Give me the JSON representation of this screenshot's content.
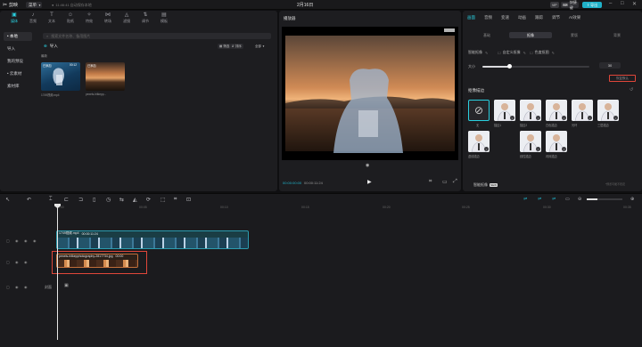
{
  "app": {
    "logo": "剪映",
    "menu_label": "菜单",
    "autosave": "11:46:41 自动保存本地",
    "doc_title": "2月16日",
    "vip_label": "VIP",
    "shortcut_label": "快捷键",
    "export_label": "导出"
  },
  "toolbar_tabs": [
    {
      "label": "媒体",
      "icon": "media-icon"
    },
    {
      "label": "音频",
      "icon": "audio-icon"
    },
    {
      "label": "文本",
      "icon": "text-icon"
    },
    {
      "label": "贴纸",
      "icon": "sticker-icon"
    },
    {
      "label": "特效",
      "icon": "effect-icon"
    },
    {
      "label": "转场",
      "icon": "transition-icon"
    },
    {
      "label": "滤镜",
      "icon": "filter-icon"
    },
    {
      "label": "调节",
      "icon": "adjust-icon"
    },
    {
      "label": "模板",
      "icon": "template-icon"
    }
  ],
  "side_nav": [
    "• 本地",
    "导入",
    "我的预设",
    "• 云素材",
    "素材库"
  ],
  "media": {
    "search_placeholder": "搜索文件名称、备用图片",
    "import_label": "导入",
    "filter_label": "筛选",
    "sort_label": "排序",
    "all_label": "全部",
    "section_label": "最新",
    "items": [
      {
        "name": "1749视频.mp4",
        "duration": "00:12",
        "badge": "已添加"
      },
      {
        "name": "pexels-hitkepp...",
        "duration": "",
        "badge": "已添加"
      }
    ]
  },
  "player": {
    "title": "播放器",
    "current_time": "00:00:00:00",
    "total_time": "00:00:11:24"
  },
  "right_panel": {
    "tabs": [
      "画面",
      "音频",
      "变速",
      "动画",
      "跟踪",
      "调节",
      "AI效果"
    ],
    "sub_tabs": [
      "基础",
      "抠像",
      "蒙版",
      "背景"
    ],
    "options": [
      "智能抠像",
      "自定义抠像",
      "色度抠图"
    ],
    "size_label": "大小",
    "size_value": "30",
    "size_fraction": 0.25,
    "reset_label": "恢复默认",
    "effects_label": "抠像描边",
    "effects": [
      {
        "name": "无"
      },
      {
        "name": "描边1"
      },
      {
        "name": "描边2"
      },
      {
        "name": "白色描边"
      },
      {
        "name": "光环"
      },
      {
        "name": "虚线描边"
      },
      {
        "name": "三层描边"
      },
      {
        "name": "线性描边"
      },
      {
        "name": "闪烁描边"
      }
    ],
    "smart_label": "智能抠像",
    "new_badge": "NEW",
    "hint": "*预览可能不稳定"
  },
  "timeline": {
    "ruler": [
      "00:00",
      "00:05",
      "00:10",
      "00:15",
      "00:20",
      "00:25",
      "00:30",
      "00:35"
    ],
    "video_clip": {
      "name": "1749视频.mp4",
      "duration": "00:00:11:24"
    },
    "photo_clip": {
      "name": "pexels-hitkepphotography-2817734.jpg",
      "duration": "00:00"
    },
    "cover_label": "封面"
  },
  "colors": {
    "accent": "#20b2c9",
    "highlight": "#e0463a"
  }
}
